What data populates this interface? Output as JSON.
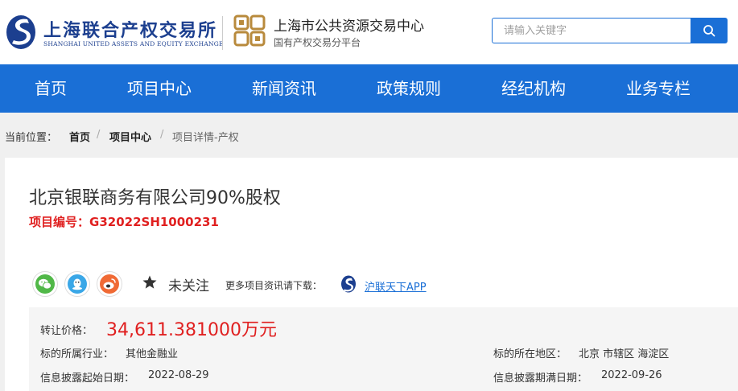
{
  "header": {
    "brand_cn": "上海联合产权交易所",
    "brand_en": "SHANGHAI UNITED ASSETS AND EQUITY EXCHANGE",
    "partner_title": "上海市公共资源交易中心",
    "partner_subtitle": "国有产权交易分平台",
    "search_placeholder": "请输入关键字"
  },
  "nav": {
    "items": [
      {
        "label": "首页"
      },
      {
        "label": "项目中心"
      },
      {
        "label": "新闻资讯"
      },
      {
        "label": "政策规则"
      },
      {
        "label": "经纪机构"
      },
      {
        "label": "业务专栏"
      }
    ]
  },
  "breadcrumb": {
    "label": "当前位置：",
    "home": "首页",
    "sep": "/",
    "center": "项目中心",
    "current": "项目详情-产权"
  },
  "project": {
    "title": "北京银联商务有限公司90%股权",
    "code_label": "项目编号：",
    "code": "G32022SH1000231",
    "follow": "未关注",
    "more_info": "更多项目资讯请下载：",
    "app_link": "沪联天下APP",
    "price_label": "转让价格：",
    "price": "34,611.381000万元",
    "industry_label": "标的所属行业：",
    "industry": "其他金融业",
    "region_label": "标的所在地区：",
    "region": "北京 市辖区 海淀区",
    "start_label": "信息披露起始日期：",
    "start_date": "2022-08-29",
    "end_label": "信息披露期满日期：",
    "end_date": "2022-09-26"
  },
  "colors": {
    "primary": "#1a6fd6",
    "brand_navy": "#1c3f8f",
    "accent_red": "#e02020",
    "gold": "#b88a3c"
  },
  "icons": [
    "sue-logo-icon",
    "resource-center-logo-icon",
    "search-icon",
    "wechat-icon",
    "qq-icon",
    "weibo-icon",
    "star-icon",
    "app-logo-icon"
  ]
}
